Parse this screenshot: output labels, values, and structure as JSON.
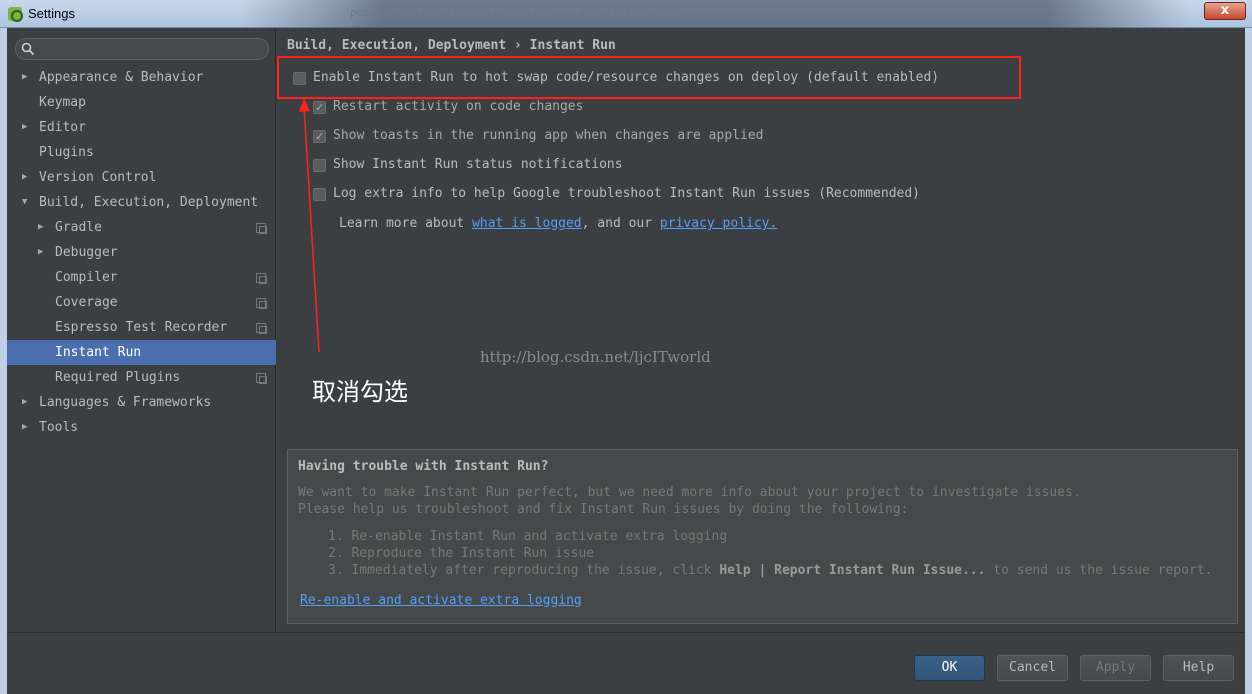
{
  "window": {
    "title": "Settings",
    "close_label": "x",
    "background_code": "public static final String TAG = \"ElasticViewHolder\";"
  },
  "search": {
    "placeholder": "",
    "value": ""
  },
  "sidebar": {
    "items": [
      {
        "label": "Appearance & Behavior",
        "level": 0,
        "arrow": "▶"
      },
      {
        "label": "Keymap",
        "level": 0,
        "arrow": ""
      },
      {
        "label": "Editor",
        "level": 0,
        "arrow": "▶"
      },
      {
        "label": "Plugins",
        "level": 0,
        "arrow": ""
      },
      {
        "label": "Version Control",
        "level": 0,
        "arrow": "▶"
      },
      {
        "label": "Build, Execution, Deployment",
        "level": 0,
        "arrow": "▼"
      },
      {
        "label": "Gradle",
        "level": 1,
        "arrow": "▶",
        "project": true
      },
      {
        "label": "Debugger",
        "level": 1,
        "arrow": "▶"
      },
      {
        "label": "Compiler",
        "level": 1,
        "arrow": "",
        "project": true
      },
      {
        "label": "Coverage",
        "level": 1,
        "arrow": "",
        "project": true
      },
      {
        "label": "Espresso Test Recorder",
        "level": 1,
        "arrow": "",
        "project": true
      },
      {
        "label": "Instant Run",
        "level": 1,
        "arrow": "",
        "selected": true
      },
      {
        "label": "Required Plugins",
        "level": 1,
        "arrow": "",
        "project": true
      },
      {
        "label": "Languages & Frameworks",
        "level": 0,
        "arrow": "▶"
      },
      {
        "label": "Tools",
        "level": 0,
        "arrow": "▶"
      }
    ]
  },
  "breadcrumb": "Build, Execution, Deployment › Instant Run",
  "options": [
    {
      "label": "Enable Instant Run to hot swap code/resource changes on deploy (default enabled)",
      "checked": false
    },
    {
      "label": "Restart activity on code changes",
      "checked": true
    },
    {
      "label": "Show toasts in the running app when changes are applied",
      "checked": true
    },
    {
      "label": "Show Instant Run status notifications",
      "checked": false
    },
    {
      "label": "Log extra info to help Google troubleshoot Instant Run issues (Recommended)",
      "checked": false
    }
  ],
  "learn_more": {
    "prefix": "Learn more about ",
    "link1": "what is logged",
    "middle": ", and our ",
    "link2": "privacy policy."
  },
  "watermark": "http://blog.csdn.net/ljcITworld",
  "annotation": "取消勾选",
  "trouble": {
    "title": "Having trouble with Instant Run?",
    "line1": "We want to make Instant Run perfect, but we need more info about your project to investigate issues.",
    "line2": "Please help us troubleshoot and fix Instant Run issues by doing the following:",
    "step1": "1. Re-enable Instant Run and activate extra logging",
    "step2": "2. Reproduce the Instant Run issue",
    "step3_prefix": "3. Immediately after reproducing the issue, click ",
    "step3_bold": "Help | Report Instant Run Issue...",
    "step3_suffix": " to send us the issue report.",
    "link": "Re-enable and activate extra logging"
  },
  "buttons": {
    "ok": "OK",
    "cancel": "Cancel",
    "apply": "Apply",
    "help": "Help"
  },
  "colors": {
    "accent": "#4b6eaf",
    "link": "#589df6",
    "highlight": "#ff2020",
    "background": "#3c3f41"
  }
}
